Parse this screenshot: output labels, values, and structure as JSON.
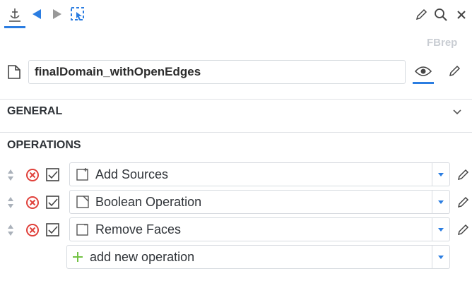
{
  "toolbar": {
    "icons": [
      "anchor-icon",
      "back-arrow-icon",
      "forward-arrow-icon",
      "select-region-icon",
      "pencil-icon",
      "search-icon",
      "close-icon"
    ]
  },
  "header": {
    "badge": "FBrep"
  },
  "object": {
    "name": "finalDomain_withOpenEdges"
  },
  "sections": {
    "general": "GENERAL",
    "operations": "OPERATIONS"
  },
  "operations": [
    {
      "label": "Add Sources"
    },
    {
      "label": "Boolean Operation"
    },
    {
      "label": "Remove Faces"
    }
  ],
  "add_operation": {
    "label": "add new operation"
  },
  "colors": {
    "accent": "#2b7de1",
    "danger": "#e0413b",
    "add": "#72c243"
  }
}
